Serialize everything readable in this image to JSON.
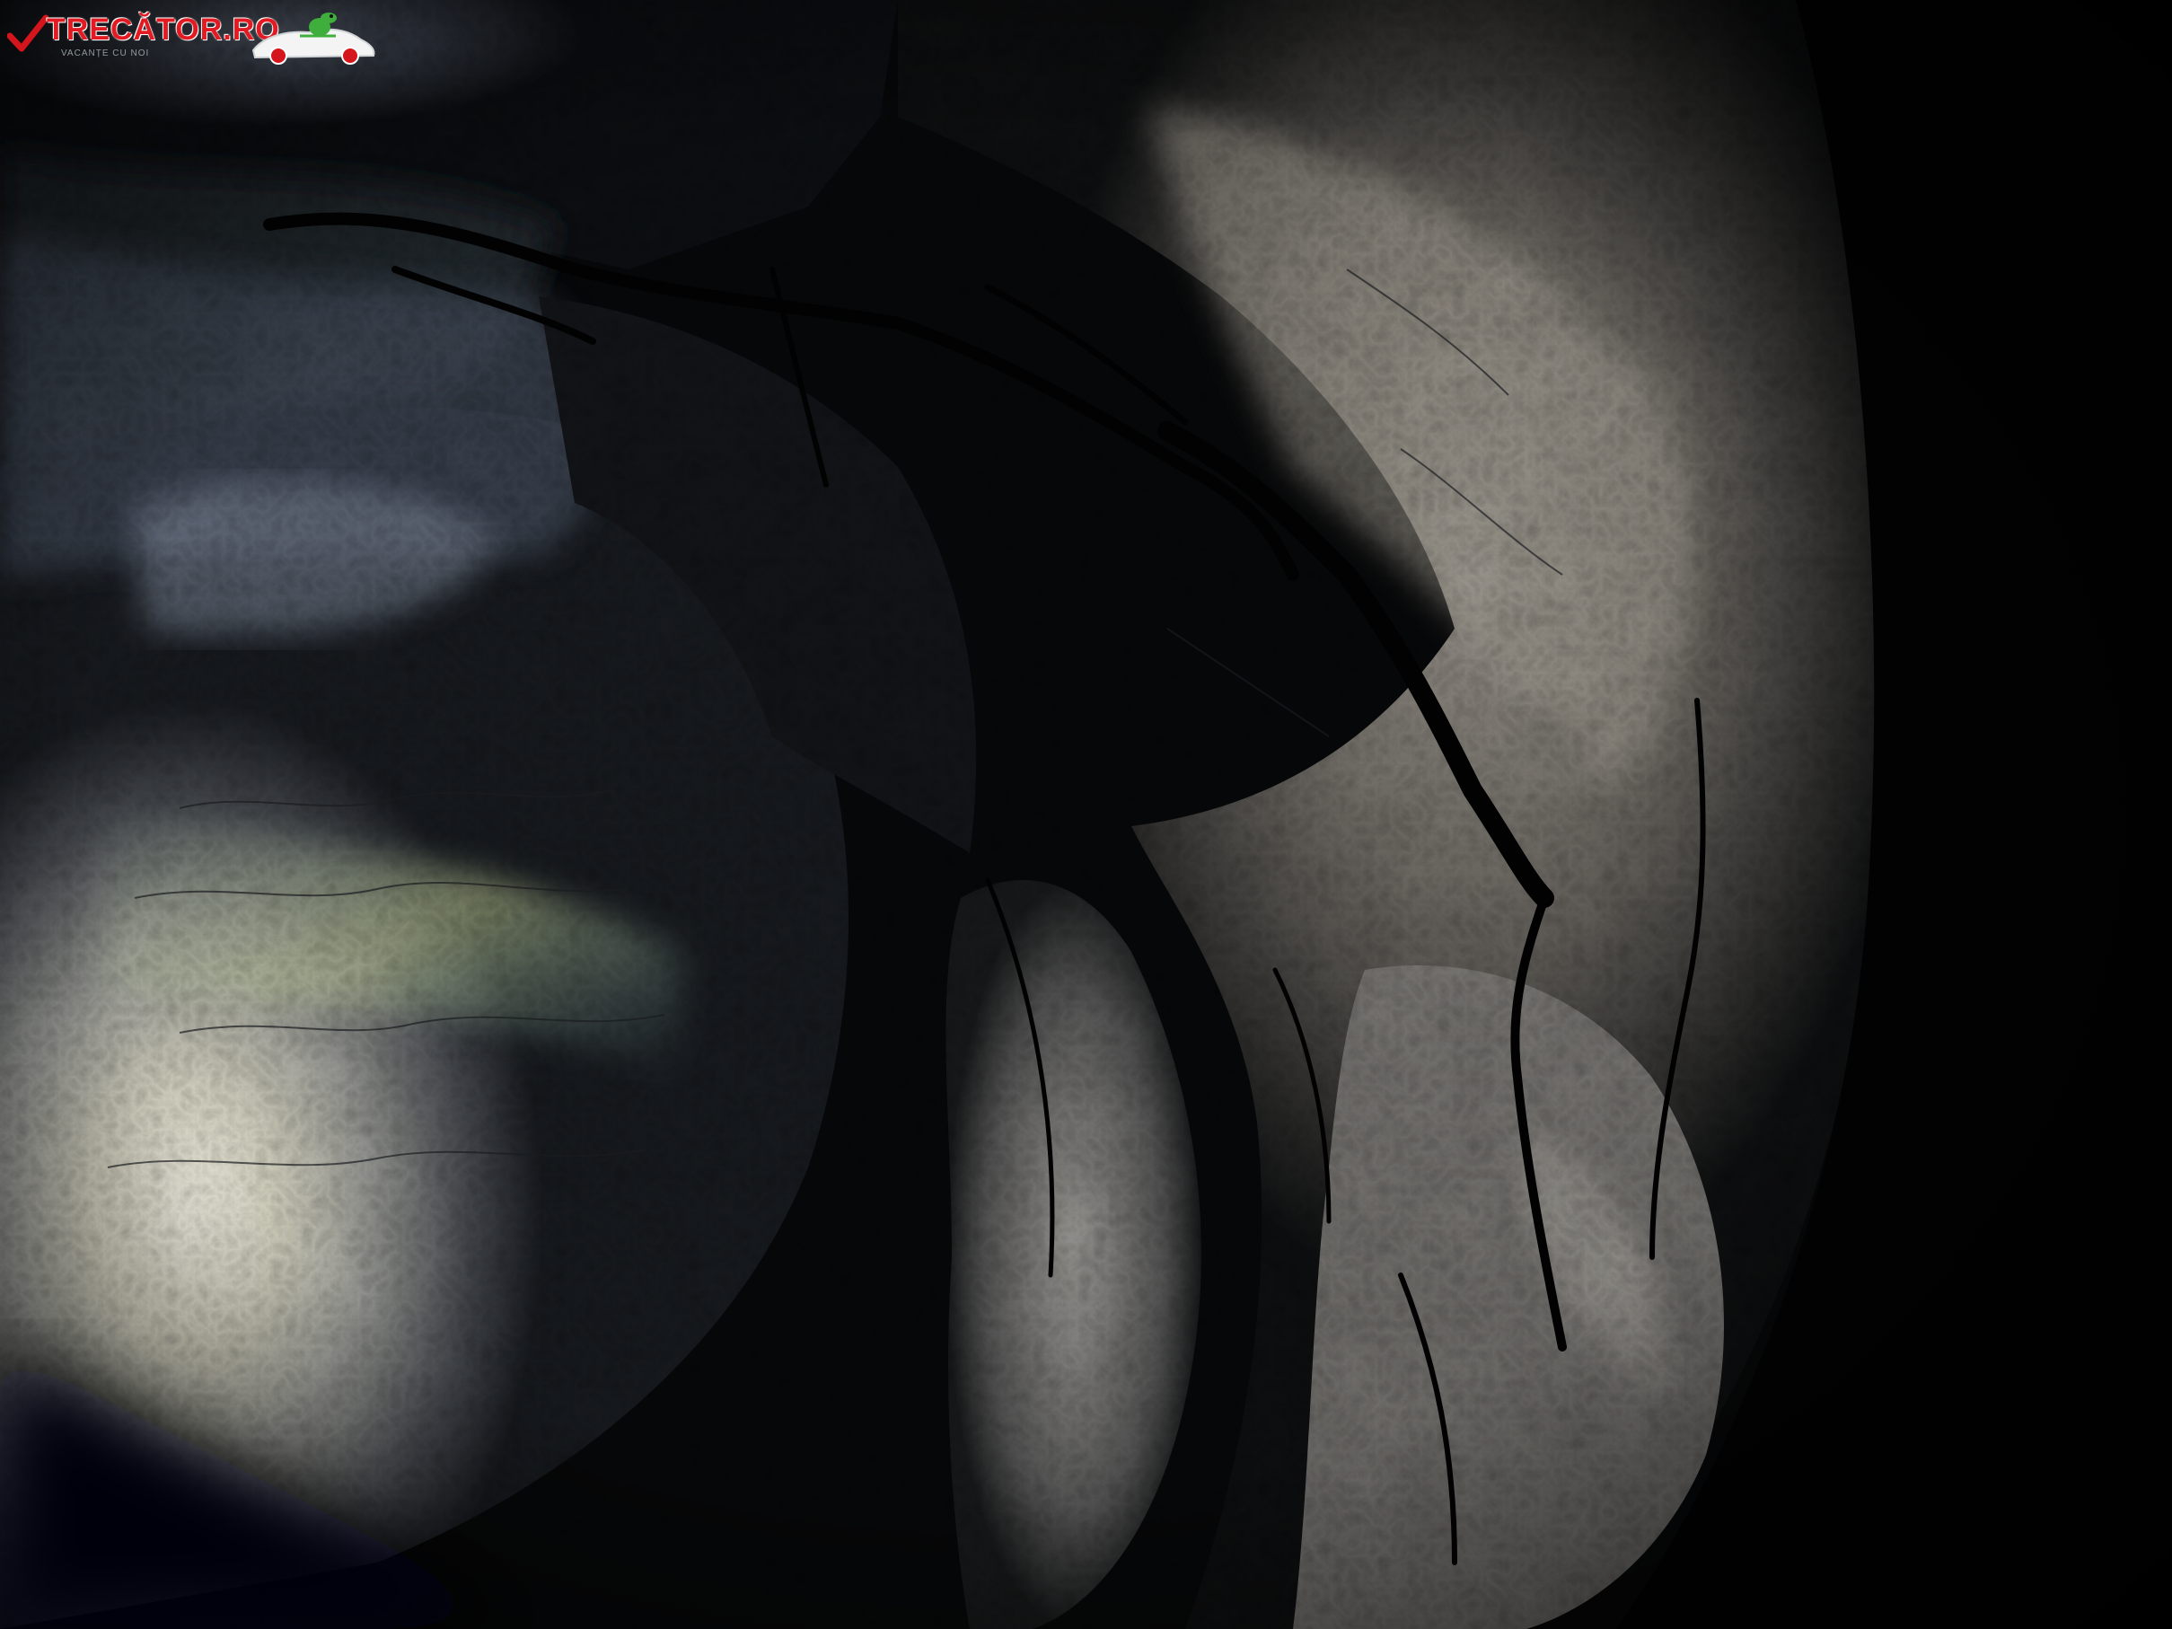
{
  "image": {
    "description_kind": "photograph",
    "subject": "limestone cave interior lit by a flashlight"
  },
  "watermark": {
    "brand": "TRECĂTOR.RO",
    "tagline": "VACANȚE CU NOI",
    "icon": "checkmark-icon",
    "mascot": "car-mascot-icon",
    "colors": {
      "brand_red": "#e21b23",
      "check_red": "#d4161c",
      "mascot_green": "#3fae3c"
    }
  }
}
